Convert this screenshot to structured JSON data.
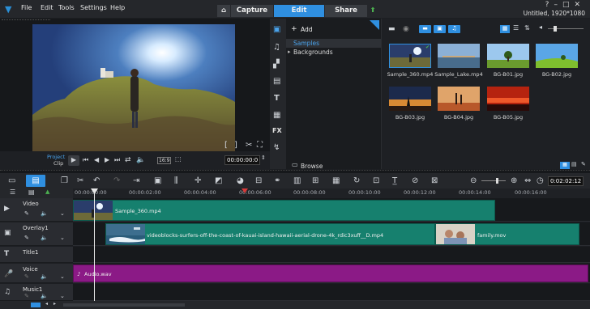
{
  "app": {
    "menu": [
      "File",
      "Edit",
      "Tools",
      "Settings",
      "Help"
    ],
    "tabs": [
      "Capture",
      "Edit",
      "Share"
    ],
    "active_tab": "Edit",
    "title_info": "Untitled, 1920*1080"
  },
  "player": {
    "project_label": "Project",
    "clip_label": "Clip",
    "timecode": "00:00:00:0",
    "size_label": "16:9"
  },
  "library": {
    "add_label": "Add",
    "folders": [
      "Samples",
      "Backgrounds"
    ],
    "selected_folder": "Samples",
    "browse_label": "Browse",
    "media": [
      {
        "label": "Sample_360.mp4",
        "kind": "360"
      },
      {
        "label": "Sample_Lake.mp4",
        "kind": "lake"
      },
      {
        "label": "BG-B01.jpg",
        "kind": "tree1"
      },
      {
        "label": "BG-B02.jpg",
        "kind": "tree2"
      },
      {
        "label": "BG-B03.jpg",
        "kind": "dusk"
      },
      {
        "label": "BG-B04.jpg",
        "kind": "desert"
      },
      {
        "label": "BG-B05.jpg",
        "kind": "sunset"
      }
    ]
  },
  "timeline": {
    "timecode": "0:02:02:12",
    "ruler": [
      "00:00:00:00",
      "00:00:02:00",
      "00:00:04:00",
      "00:00:06:00",
      "00:00:08:00",
      "00:00:10:00",
      "00:00:12:00",
      "00:00:14:00",
      "00:00:16:00"
    ],
    "tracks": [
      {
        "name": "Video"
      },
      {
        "name": "Overlay1"
      },
      {
        "name": "Title1"
      },
      {
        "name": "Voice"
      },
      {
        "name": "Music1"
      }
    ],
    "clips": {
      "video": "Sample_360.mp4",
      "overlay_a": "videoblocks-surfers-off-the-coast-of-kauai-island-hawaii-aerial-drone-4k_rdic3xuff__D.mp4",
      "overlay_b": "family.mov",
      "voice": "Audio.wav"
    }
  },
  "colors": {
    "accent": "#2f8fe0",
    "video_clip": "#16806e",
    "voice_clip": "#8b1a86",
    "playhead": "#e8e8e8"
  }
}
